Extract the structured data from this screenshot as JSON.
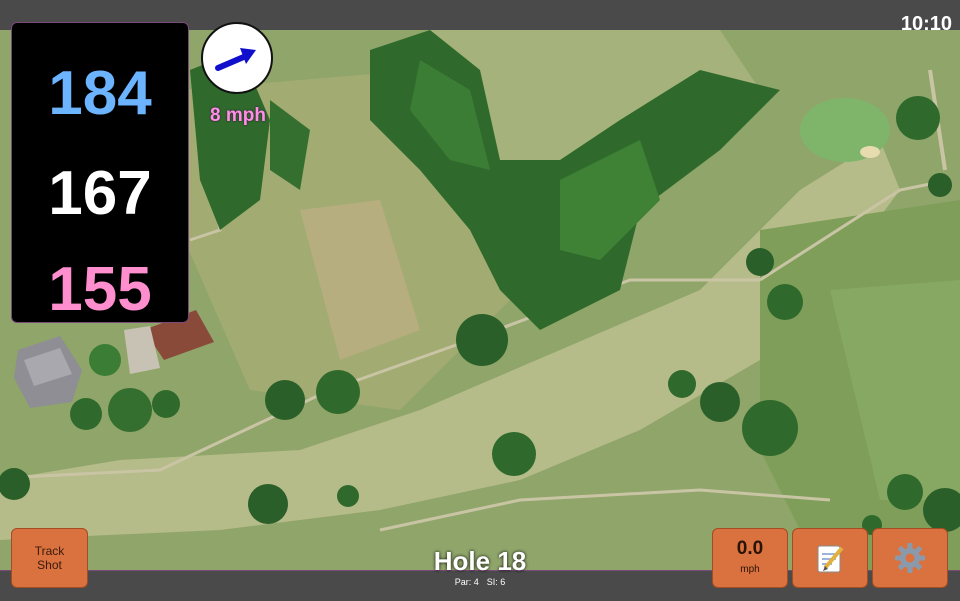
{
  "status": {
    "time": "10:10"
  },
  "distances": {
    "back": "184",
    "middle": "167",
    "front": "155"
  },
  "wind": {
    "speed_label": "8 mph"
  },
  "buttons": {
    "track_shot": "Track Shot",
    "speed_value": "0.0",
    "speed_unit": "mph"
  },
  "hole": {
    "title": "Hole 18",
    "par_label": "Par: 4",
    "si_label": "SI: 6"
  },
  "icons": {
    "wind": "wind-arrow-icon",
    "notes": "notepad-icon",
    "settings": "gear-icon"
  },
  "colors": {
    "back": "#6cb4ff",
    "middle": "#ffffff",
    "front": "#ff8ecf",
    "button": "#d9723f",
    "wind_text": "#ff8ee6"
  }
}
